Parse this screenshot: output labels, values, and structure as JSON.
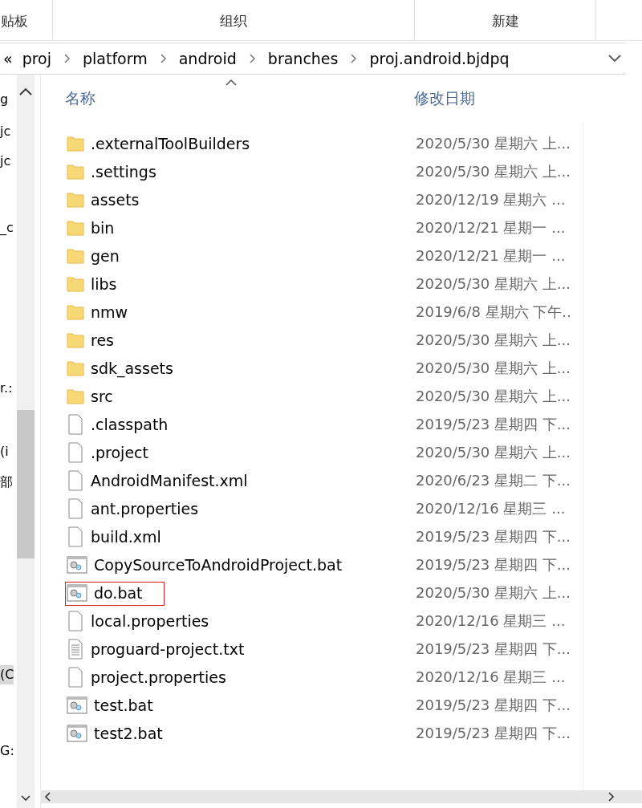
{
  "ribbon": {
    "groups": [
      "贴板",
      "组织",
      "新建"
    ]
  },
  "breadcrumb": {
    "overflow": "«",
    "items": [
      "proj",
      "platform",
      "android",
      "branches",
      "proj.android.bjdpq"
    ]
  },
  "nav_pane": {
    "items": [
      {
        "label": "g",
        "selected": false
      },
      {
        "label": "jc",
        "selected": false
      },
      {
        "label": "jc",
        "selected": false
      },
      {
        "label": "_c",
        "selected": false
      },
      {
        "label": "r.:",
        "selected": false
      },
      {
        "label": "(i",
        "selected": false
      },
      {
        "label": "部",
        "selected": false
      },
      {
        "label": "(C",
        "selected": true
      },
      {
        "label": "G:",
        "selected": false
      }
    ]
  },
  "table": {
    "columns": [
      "名称",
      "修改日期"
    ],
    "rows": [
      {
        "kind": "folder",
        "name": ".externalToolBuilders",
        "modified": "2020/5/30 星期六 上...",
        "marked": false
      },
      {
        "kind": "folder",
        "name": ".settings",
        "modified": "2020/5/30 星期六 上...",
        "marked": false
      },
      {
        "kind": "folder",
        "name": "assets",
        "modified": "2020/12/19 星期六 ...",
        "marked": false
      },
      {
        "kind": "folder",
        "name": "bin",
        "modified": "2020/12/21 星期一 ...",
        "marked": false
      },
      {
        "kind": "folder",
        "name": "gen",
        "modified": "2020/12/21 星期一 ...",
        "marked": false
      },
      {
        "kind": "folder",
        "name": "libs",
        "modified": "2020/5/30 星期六 上...",
        "marked": false
      },
      {
        "kind": "folder",
        "name": "nmw",
        "modified": "2019/6/8 星期六 下午..",
        "marked": false
      },
      {
        "kind": "folder",
        "name": "res",
        "modified": "2020/5/30 星期六 上...",
        "marked": false
      },
      {
        "kind": "folder",
        "name": "sdk_assets",
        "modified": "2020/5/30 星期六 上...",
        "marked": false
      },
      {
        "kind": "folder",
        "name": "src",
        "modified": "2020/5/30 星期六 上...",
        "marked": false
      },
      {
        "kind": "file",
        "name": ".classpath",
        "modified": "2019/5/23 星期四 下...",
        "marked": false
      },
      {
        "kind": "file",
        "name": ".project",
        "modified": "2020/5/30 星期六 上...",
        "marked": false
      },
      {
        "kind": "file",
        "name": "AndroidManifest.xml",
        "modified": "2020/6/23 星期二 下...",
        "marked": false
      },
      {
        "kind": "file",
        "name": "ant.properties",
        "modified": "2020/12/16 星期三 ...",
        "marked": false
      },
      {
        "kind": "file",
        "name": "build.xml",
        "modified": "2019/5/23 星期四 下...",
        "marked": false
      },
      {
        "kind": "batch",
        "name": "CopySourceToAndroidProject.bat",
        "modified": "2019/5/23 星期四 下...",
        "marked": false
      },
      {
        "kind": "batch",
        "name": "do.bat",
        "modified": "2020/5/30 星期六 上...",
        "marked": true
      },
      {
        "kind": "file",
        "name": "local.properties",
        "modified": "2020/12/16 星期三 ...",
        "marked": false
      },
      {
        "kind": "text",
        "name": "proguard-project.txt",
        "modified": "2019/5/23 星期四 下...",
        "marked": false
      },
      {
        "kind": "file",
        "name": "project.properties",
        "modified": "2020/12/16 星期三 ...",
        "marked": false
      },
      {
        "kind": "batch",
        "name": "test.bat",
        "modified": "2019/5/23 星期四 下...",
        "marked": false
      },
      {
        "kind": "batch",
        "name": "test2.bat",
        "modified": "2019/5/23 星期四 下...",
        "marked": false
      }
    ]
  }
}
